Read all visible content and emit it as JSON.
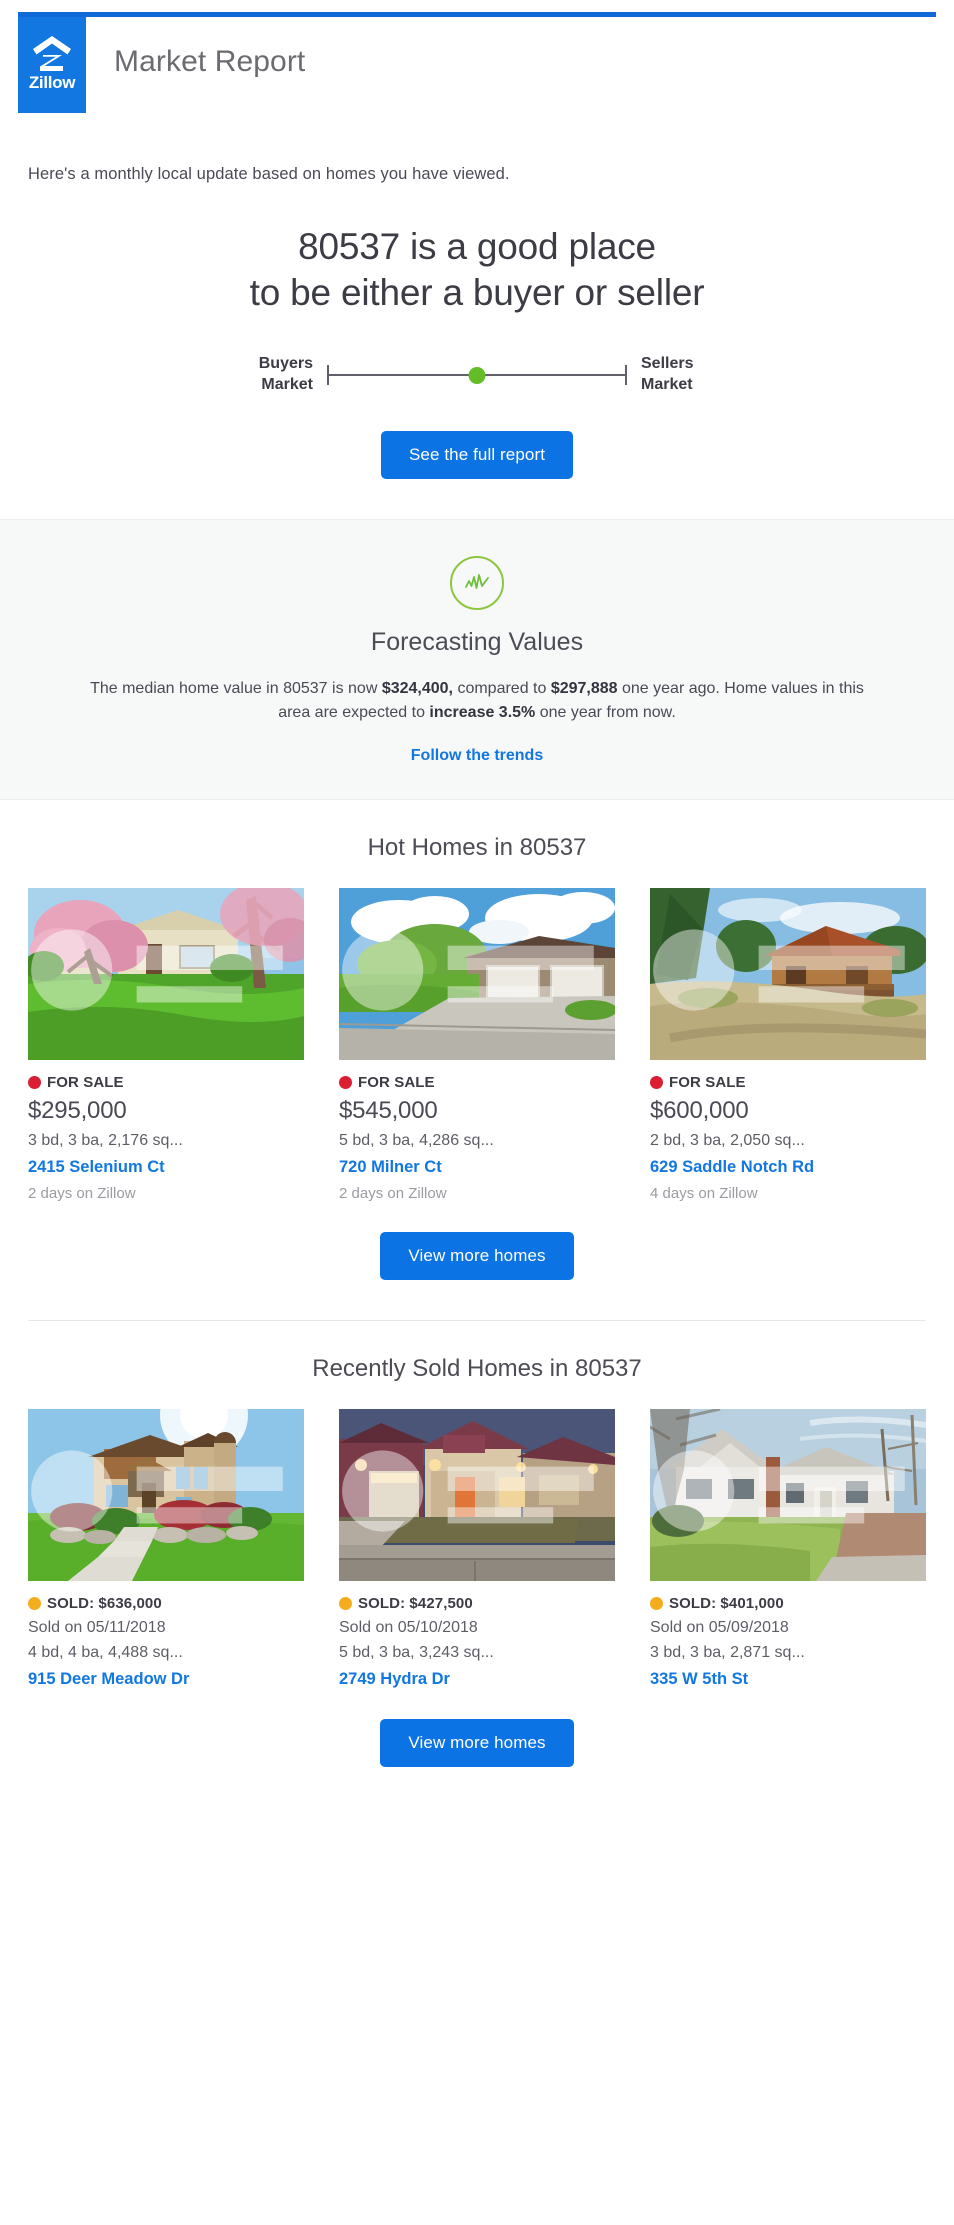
{
  "brand": {
    "name": "Zillow",
    "logo_icon": "zillow-house-icon",
    "accent_blue": "#1277e1",
    "button_blue": "#0c73e4",
    "green": "#64bc26",
    "forsale_red": "#dc1e32",
    "sold_yellow": "#f5ad1d"
  },
  "header": {
    "title": "Market Report"
  },
  "intro": {
    "text": "Here's a monthly local update based on homes you have viewed."
  },
  "hero": {
    "headline_line1": "80537 is a good place",
    "headline_line2": "to be either a buyer or seller",
    "slider": {
      "left_label_line1": "Buyers",
      "left_label_line2": "Market",
      "right_label_line1": "Sellers",
      "right_label_line2": "Market",
      "position_percent": 50
    },
    "cta_label": "See the full report"
  },
  "forecast": {
    "icon": "trend-line-icon",
    "title": "Forecasting Values",
    "body_part1": "The median home value in 80537 is now ",
    "median_value": "$324,400,",
    "body_part2": " compared to ",
    "prior_value": "$297,888",
    "body_part3": " one year ago. Home values in this area are expected to ",
    "change_value": "increase 3.5%",
    "body_part4": " one year from now.",
    "link_label": "Follow the trends"
  },
  "hot_homes": {
    "title": "Hot Homes in 80537",
    "cta_label": "View more homes",
    "listings": [
      {
        "photo": "ranch-house-blossom-trees",
        "status": "FOR SALE",
        "price": "$295,000",
        "details": "3 bd, 3 ba, 2,176 sq...",
        "address": "2415 Selenium Ct",
        "meta": "2 days on Zillow"
      },
      {
        "photo": "stone-house-three-car-garage",
        "status": "FOR SALE",
        "price": "$545,000",
        "details": "5 bd, 3 ba, 4,286 sq...",
        "address": "720 Milner Ct",
        "meta": "2 days on Zillow"
      },
      {
        "photo": "log-cabin-mountain",
        "status": "FOR SALE",
        "price": "$600,000",
        "details": "2 bd, 3 ba, 2,050 sq...",
        "address": "629 Saddle Notch Rd",
        "meta": "4 days on Zillow"
      }
    ]
  },
  "sold_homes": {
    "title": "Recently Sold Homes in 80537",
    "cta_label": "View more homes",
    "listings": [
      {
        "photo": "two-story-stucco-timber-home",
        "status": "SOLD: $636,000",
        "sold_on": "Sold on 05/11/2018",
        "details": "4 bd, 4 ba, 4,488 sq...",
        "address": "915 Deer Meadow Dr"
      },
      {
        "photo": "craftsman-home-dusk",
        "status": "SOLD: $427,500",
        "sold_on": "Sold on 05/10/2018",
        "details": "5 bd, 3 ba, 3,243 sq...",
        "address": "2749 Hydra Dr"
      },
      {
        "photo": "white-cottage-bare-trees",
        "status": "SOLD: $401,000",
        "sold_on": "Sold on 05/09/2018",
        "details": "3 bd, 3 ba, 2,871 sq...",
        "address": "335 W 5th St"
      }
    ]
  }
}
